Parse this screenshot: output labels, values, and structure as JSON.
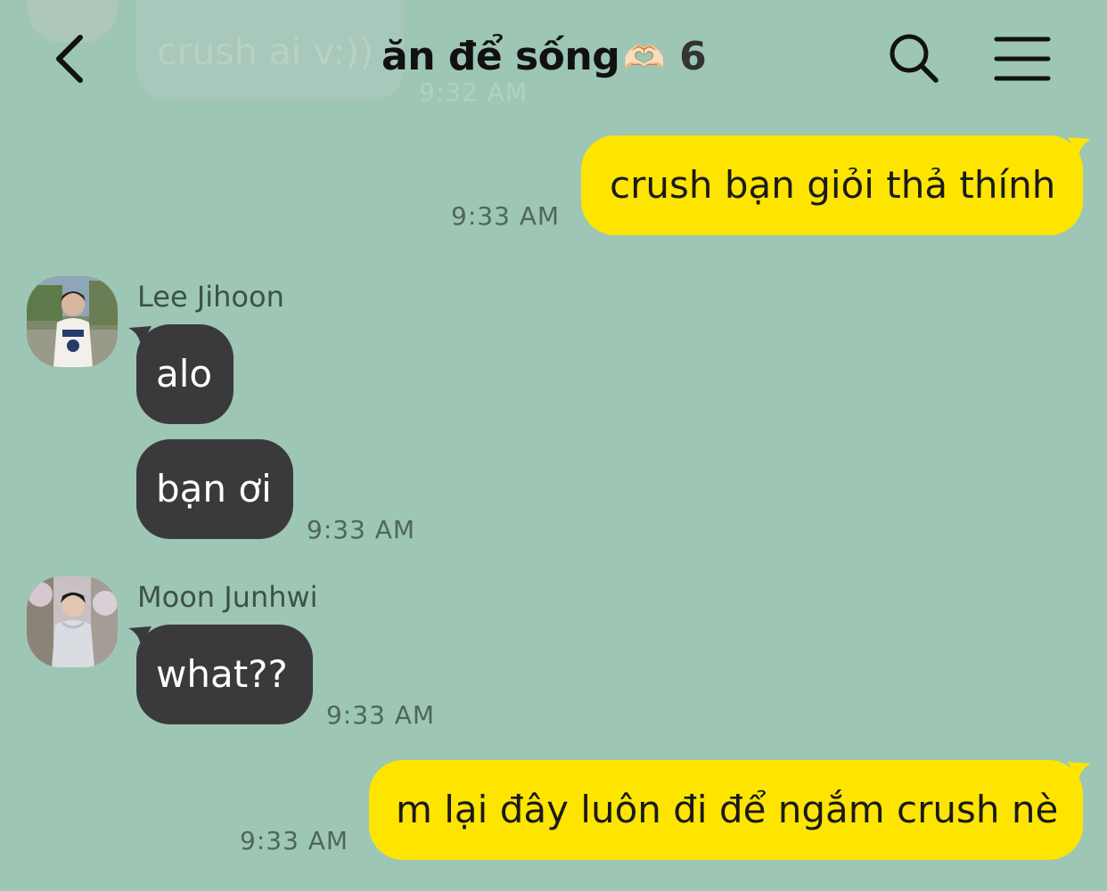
{
  "header": {
    "title": "ăn để sống",
    "title_emoji": "🫶🏻",
    "member_count": "6"
  },
  "ghost_message": {
    "text": "crush ai v:))",
    "time": "9:32 AM"
  },
  "messages": [
    {
      "from": "me",
      "text": "crush bạn giỏi thả thính",
      "time": "9:33 AM"
    },
    {
      "from": "Lee Jihoon",
      "sender": "Lee Jihoon",
      "texts": [
        "alo",
        "bạn ơi"
      ],
      "time": "9:33 AM"
    },
    {
      "from": "Moon Junhwi",
      "sender": "Moon Junhwi",
      "texts": [
        "what??"
      ],
      "time": "9:33 AM"
    },
    {
      "from": "me",
      "text": "m lại đây luôn đi để ngắm crush nè",
      "time": "9:33 AM"
    }
  ],
  "colors": {
    "background": "#9dc6b5",
    "my_bubble": "#fee500",
    "their_bubble": "#3a3a3c"
  },
  "icons": {
    "back": "chevron-left-icon",
    "search": "search-icon",
    "menu": "hamburger-menu-icon"
  }
}
